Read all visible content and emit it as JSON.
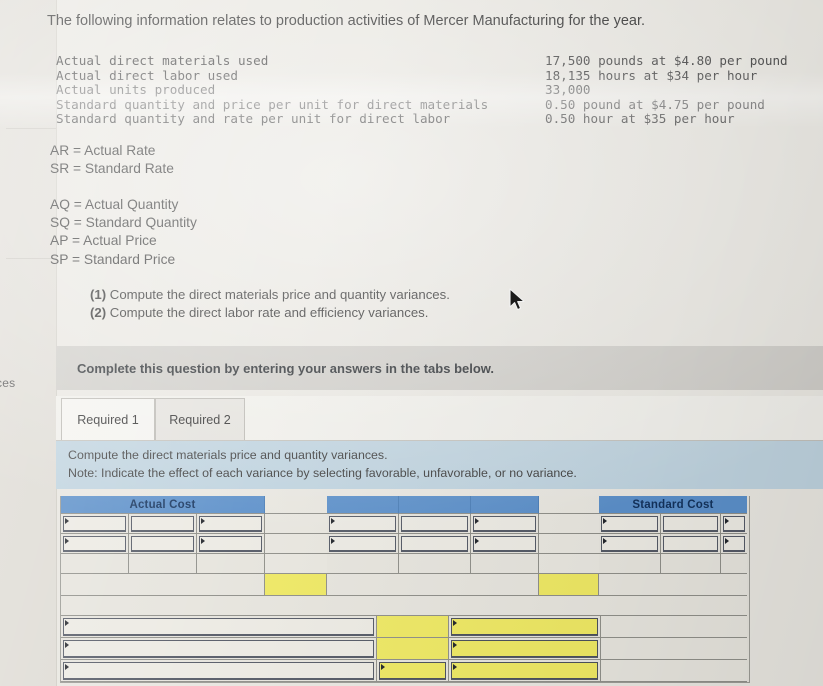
{
  "intro": {
    "text": "The following information relates to production activities of Mercer Manufacturing for the year."
  },
  "facts": [
    {
      "label": "Actual direct materials used",
      "value": "17,500 pounds at $4.80 per pound"
    },
    {
      "label": "Actual direct labor used",
      "value": "18,135 hours at $34 per hour"
    },
    {
      "label": "Actual units produced",
      "value": "33,000"
    },
    {
      "label": "Standard quantity and price per unit for direct materials",
      "value": "0.50 pound at $4.75 per pound"
    },
    {
      "label": "Standard quantity and rate per unit for direct labor",
      "value": "0.50 hour at $35 per hour"
    }
  ],
  "definitions_group_1": [
    "AR = Actual Rate",
    "SR = Standard Rate"
  ],
  "definitions_group_2": [
    "AQ = Actual Quantity",
    "SQ = Standard Quantity",
    "AP = Actual Price",
    "SP = Standard Price"
  ],
  "requirements": [
    {
      "number": "(1)",
      "text": "Compute the direct materials price and quantity variances."
    },
    {
      "number": "(2)",
      "text": "Compute the direct labor rate and efficiency variances."
    }
  ],
  "complete_band": {
    "text": "Complete this question by entering your answers in the tabs below."
  },
  "tabs": [
    {
      "label": "Required 1",
      "selected": true
    },
    {
      "label": "Required 2",
      "selected": false
    }
  ],
  "instructions": {
    "line1": "Compute the direct materials price and quantity variances.",
    "line2": "Note: Indicate the effect of each variance by selecting favorable, unfavorable, or no variance."
  },
  "answer_grid": {
    "headers": {
      "actual_cost": "Actual Cost",
      "standard_cost": "Standard Cost"
    },
    "rows": [
      {
        "cells": [
          "",
          "",
          "",
          "",
          "",
          "",
          "",
          "",
          "",
          "",
          ""
        ]
      },
      {
        "cells": [
          "",
          "",
          "",
          "",
          "",
          "",
          "",
          "",
          "",
          "",
          ""
        ]
      },
      {
        "cells": [
          "",
          "",
          "",
          "",
          "",
          "",
          "",
          "",
          "",
          "",
          ""
        ]
      },
      {
        "cells": [
          "",
          "",
          "",
          "",
          "",
          ""
        ]
      },
      {
        "cells": [
          ""
        ]
      },
      {
        "cells": [
          "",
          "",
          "",
          ""
        ]
      },
      {
        "cells": [
          "",
          "",
          "",
          ""
        ]
      },
      {
        "cells": [
          "",
          "",
          "",
          ""
        ]
      }
    ]
  },
  "left_panel": {
    "clipped_label": "ces"
  },
  "colors": {
    "header_blue": "#5b8fc9",
    "instruction_band_blue": "#bed2de",
    "complete_band_grey": "#cdcbc6",
    "highlight_yellow": "#eee864",
    "page_background": "#e8e6e0"
  }
}
